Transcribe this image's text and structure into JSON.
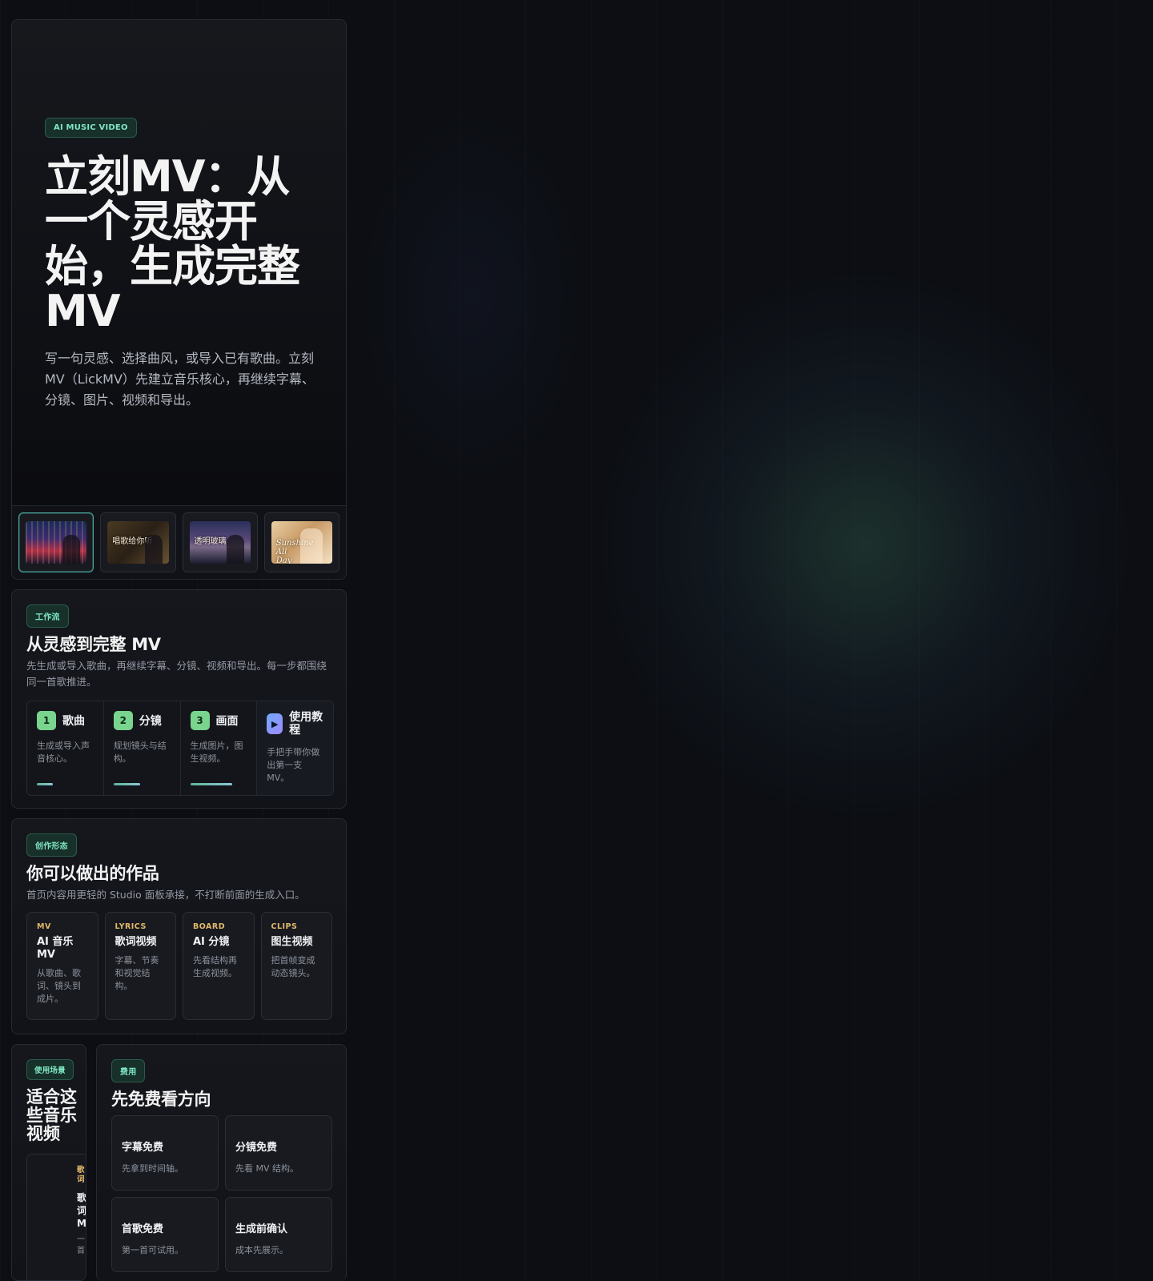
{
  "hero": {
    "badge": "AI MUSIC VIDEO",
    "title": "立刻MV：从一个灵感开始，生成完整 MV",
    "description": "写一句灵感、选择曲风，或导入已有歌曲。立刻MV（LickMV）先建立音乐核心，再继续字幕、分镜、图片、视频和导出。",
    "thumbnails": [
      {
        "caption": "",
        "style": "city-night-neon"
      },
      {
        "caption": "唱歌给你听",
        "style": "warm-vintage"
      },
      {
        "caption": "透明玻璃",
        "style": "twilight-room"
      },
      {
        "caption": "Sunshine All Day",
        "style": "golden-portrait"
      }
    ]
  },
  "workflow": {
    "badge": "工作流",
    "title": "从灵感到完整 MV",
    "description": "先生成或导入歌曲，再继续字幕、分镜、视频和导出。每一步都围绕同一首歌推进。",
    "steps": [
      {
        "num": "1",
        "label": "歌曲",
        "text": "生成或导入声音核心。"
      },
      {
        "num": "2",
        "label": "分镜",
        "text": "规划镜头与结构。"
      },
      {
        "num": "3",
        "label": "画面",
        "text": "生成图片，图生视频。"
      }
    ],
    "tutorial": {
      "icon": "play-icon",
      "label": "使用教程",
      "text": "手把手带你做出第一支 MV。"
    }
  },
  "works": {
    "badge": "创作形态",
    "title": "你可以做出的作品",
    "description": "首页内容用更轻的 Studio 面板承接，不打断前面的生成入口。",
    "cards": [
      {
        "tag": "MV",
        "title": "AI 音乐 MV",
        "text": "从歌曲、歌词、镜头到成片。"
      },
      {
        "tag": "LYRICS",
        "title": "歌词视频",
        "text": "字幕、节奏和视觉结构。"
      },
      {
        "tag": "BOARD",
        "title": "AI 分镜",
        "text": "先看结构再生成视频。"
      },
      {
        "tag": "CLIPS",
        "title": "图生视频",
        "text": "把首帧变成动态镜头。"
      }
    ]
  },
  "scenarios": {
    "badge": "使用场景",
    "title": "适合这些音乐视频",
    "card": {
      "tag": "歌词",
      "title": "歌词 M",
      "text": "一首"
    }
  },
  "cost": {
    "badge": "费用",
    "title": "先免费看方向",
    "items": [
      {
        "title": "字幕免费",
        "text": "先拿到时间轴。"
      },
      {
        "title": "分镜免费",
        "text": "先看 MV 结构。"
      },
      {
        "title": "首歌免费",
        "text": "第一首可试用。"
      },
      {
        "title": "生成前确认",
        "text": "成本先展示。"
      }
    ]
  },
  "colors": {
    "accent": "#7fe8c3",
    "badge_bg": "#17302a",
    "step_num": "#79d48e",
    "card_tag": "#e3b86a",
    "background": "#0c0e13"
  }
}
